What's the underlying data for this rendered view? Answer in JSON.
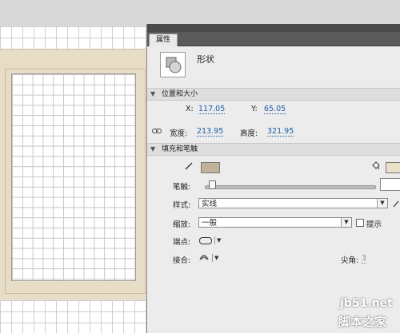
{
  "panel": {
    "tab_title": "属性",
    "object_type": "形状"
  },
  "position_size": {
    "header": "位置和大小",
    "x_label": "X:",
    "x_value": "117.05",
    "y_label": "Y:",
    "y_value": "65.05",
    "width_label": "宽度:",
    "width_value": "213.95",
    "height_label": "高度:",
    "height_value": "321.95"
  },
  "fill_stroke": {
    "header": "填充和笔触",
    "stroke_color": "#c2b29b",
    "fill_color": "#eae0c8",
    "stroke_label": "笔触:",
    "stroke_value_fraction": 0.04,
    "style_label": "样式:",
    "style_value": "实线",
    "scale_label": "缩放:",
    "scale_value": "一般",
    "hint_label": "提示",
    "cap_label": "端点:",
    "join_label": "接合:",
    "miter_label": "尖角:",
    "miter_value": "3"
  },
  "watermark": {
    "line1": "jb51.net",
    "line2": "脚本之家"
  }
}
